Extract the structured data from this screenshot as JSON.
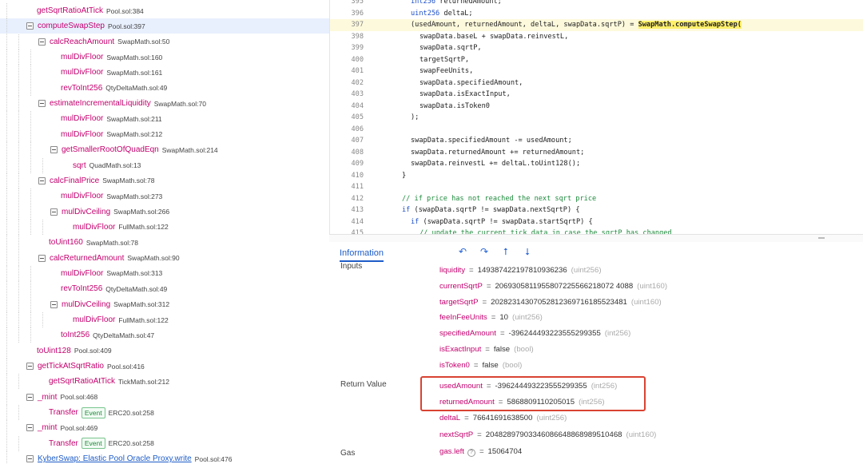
{
  "trace": [
    {
      "fn": "getSqrtRatioAtTick",
      "src": "Pool.sol:384",
      "indent": 1,
      "toggle": false
    },
    {
      "fn": "computeSwapStep",
      "src": "Pool.sol:397",
      "indent": 1,
      "toggle": true,
      "highlight": true
    },
    {
      "fn": "calcReachAmount",
      "src": "SwapMath.sol:50",
      "indent": 2,
      "toggle": true
    },
    {
      "fn": "mulDivFloor",
      "src": "SwapMath.sol:160",
      "indent": 3,
      "toggle": false
    },
    {
      "fn": "mulDivFloor",
      "src": "SwapMath.sol:161",
      "indent": 3,
      "toggle": false
    },
    {
      "fn": "revToInt256",
      "src": "QtyDeltaMath.sol:49",
      "indent": 3,
      "toggle": false
    },
    {
      "fn": "estimateIncrementalLiquidity",
      "src": "SwapMath.sol:70",
      "indent": 2,
      "toggle": true
    },
    {
      "fn": "mulDivFloor",
      "src": "SwapMath.sol:211",
      "indent": 3,
      "toggle": false
    },
    {
      "fn": "mulDivFloor",
      "src": "SwapMath.sol:212",
      "indent": 3,
      "toggle": false
    },
    {
      "fn": "getSmallerRootOfQuadEqn",
      "src": "SwapMath.sol:214",
      "indent": 3,
      "toggle": true
    },
    {
      "fn": "sqrt",
      "src": "QuadMath.sol:13",
      "indent": 4,
      "toggle": false
    },
    {
      "fn": "calcFinalPrice",
      "src": "SwapMath.sol:78",
      "indent": 2,
      "toggle": true
    },
    {
      "fn": "mulDivFloor",
      "src": "SwapMath.sol:273",
      "indent": 3,
      "toggle": false
    },
    {
      "fn": "mulDivCeiling",
      "src": "SwapMath.sol:266",
      "indent": 3,
      "toggle": true
    },
    {
      "fn": "mulDivFloor",
      "src": "FullMath.sol:122",
      "indent": 4,
      "toggle": false
    },
    {
      "fn": "toUint160",
      "src": "SwapMath.sol:78",
      "indent": 2,
      "toggle": false
    },
    {
      "fn": "calcReturnedAmount",
      "src": "SwapMath.sol:90",
      "indent": 2,
      "toggle": true
    },
    {
      "fn": "mulDivFloor",
      "src": "SwapMath.sol:313",
      "indent": 3,
      "toggle": false
    },
    {
      "fn": "revToInt256",
      "src": "QtyDeltaMath.sol:49",
      "indent": 3,
      "toggle": false
    },
    {
      "fn": "mulDivCeiling",
      "src": "SwapMath.sol:312",
      "indent": 3,
      "toggle": true
    },
    {
      "fn": "mulDivFloor",
      "src": "FullMath.sol:122",
      "indent": 4,
      "toggle": false
    },
    {
      "fn": "toInt256",
      "src": "QtyDeltaMath.sol:47",
      "indent": 3,
      "toggle": false
    },
    {
      "fn": "toUint128",
      "src": "Pool.sol:409",
      "indent": 1,
      "toggle": false
    },
    {
      "fn": "getTickAtSqrtRatio",
      "src": "Pool.sol:416",
      "indent": 1,
      "toggle": true
    },
    {
      "fn": "getSqrtRatioAtTick",
      "src": "TickMath.sol:212",
      "indent": 2,
      "toggle": false
    },
    {
      "fn": "_mint",
      "src": "Pool.sol:468",
      "indent": 1,
      "toggle": true
    },
    {
      "fn": "Transfer",
      "badge": "Event",
      "src": "ERC20.sol:258",
      "indent": 2,
      "toggle": false
    },
    {
      "fn": "_mint",
      "src": "Pool.sol:469",
      "indent": 1,
      "toggle": true
    },
    {
      "fn": "Transfer",
      "badge": "Event",
      "src": "ERC20.sol:258",
      "indent": 2,
      "toggle": false
    },
    {
      "fn": "KyberSwap: Elastic Pool Oracle Proxy.write",
      "src": "Pool.sol:476",
      "indent": 1,
      "toggle": true,
      "blue": true
    }
  ],
  "code": [
    {
      "ln": "395",
      "text": "int256 returnedAmount;",
      "indent": 1
    },
    {
      "ln": "396",
      "text": "uint256 deltaL;",
      "indent": 1
    },
    {
      "ln": "397",
      "text": "(usedAmount, returnedAmount, deltaL, swapData.sqrtP) = ",
      "call": "SwapMath.computeSwapStep(",
      "indent": 1,
      "highlight": true
    },
    {
      "ln": "398",
      "text": "swapData.baseL + swapData.reinvestL,",
      "indent": 2
    },
    {
      "ln": "399",
      "text": "swapData.sqrtP,",
      "indent": 2
    },
    {
      "ln": "400",
      "text": "targetSqrtP,",
      "indent": 2
    },
    {
      "ln": "401",
      "text": "swapFeeUnits,",
      "indent": 2
    },
    {
      "ln": "402",
      "text": "swapData.specifiedAmount,",
      "indent": 2
    },
    {
      "ln": "403",
      "text": "swapData.isExactInput,",
      "indent": 2
    },
    {
      "ln": "404",
      "text": "swapData.isToken0",
      "indent": 2
    },
    {
      "ln": "405",
      "text": ");",
      "indent": 1
    },
    {
      "ln": "406",
      "text": "",
      "indent": 0
    },
    {
      "ln": "407",
      "text": "swapData.specifiedAmount -= usedAmount;",
      "indent": 1
    },
    {
      "ln": "408",
      "text": "swapData.returnedAmount += returnedAmount;",
      "indent": 1
    },
    {
      "ln": "409",
      "text": "swapData.reinvestL += deltaL.toUint128();",
      "indent": 1
    },
    {
      "ln": "410",
      "text": "}",
      "indent": 0
    },
    {
      "ln": "411",
      "text": "",
      "indent": 0
    },
    {
      "ln": "412",
      "text": "// if price has not reached the next sqrt price",
      "indent": 0,
      "comment": true
    },
    {
      "ln": "413",
      "text": "if (swapData.sqrtP != swapData.nextSqrtP) {",
      "indent": 0
    },
    {
      "ln": "414",
      "text": "if (swapData.sqrtP != swapData.startSqrtP) {",
      "indent": 1
    },
    {
      "ln": "415",
      "text": "// update the current tick data in case the sqrtP has changed",
      "indent": 2,
      "comment": true
    },
    {
      "ln": "416",
      "text": "swapData.currentTick = TickMath.getTickAtSqrtRatio(swapData.sqrtP);",
      "indent": 2
    }
  ],
  "info": {
    "tab_label": "Information",
    "step_icons": [
      "step-back-icon",
      "step-over-icon",
      "step-out-icon",
      "step-into-icon"
    ],
    "sections": {
      "inputs": "Inputs",
      "return_value": "Return Value",
      "gas": "Gas"
    },
    "inputs": [
      {
        "k": "liquidity",
        "v": "149387422197810936236",
        "t": "(uint256)"
      },
      {
        "k": "currentSqrtP",
        "v": "2069305811955807225566218072 4088",
        "t": "(uint160)"
      },
      {
        "k": "targetSqrtP",
        "v": "20282314307052812369716185523481",
        "t": "(uint160)"
      },
      {
        "k": "feeInFeeUnits",
        "v": "10",
        "t": "(uint256)"
      },
      {
        "k": "specifiedAmount",
        "v": "-396244493223555299355",
        "t": "(int256)"
      },
      {
        "k": "isExactInput",
        "v": "false",
        "t": "(bool)"
      },
      {
        "k": "isToken0",
        "v": "false",
        "t": "(bool)"
      }
    ],
    "returns": [
      {
        "k": "usedAmount",
        "v": "-396244493223555299355",
        "t": "(int256)"
      },
      {
        "k": "returnedAmount",
        "v": "5868809110205015",
        "t": "(int256)"
      },
      {
        "k": "deltaL",
        "v": "76641691638500",
        "t": "(uint256)"
      },
      {
        "k": "nextSqrtP",
        "v": "20482897903346086648868989510468",
        "t": "(uint160)"
      }
    ],
    "gas": {
      "k": "gas.left",
      "v": "15064704"
    }
  }
}
